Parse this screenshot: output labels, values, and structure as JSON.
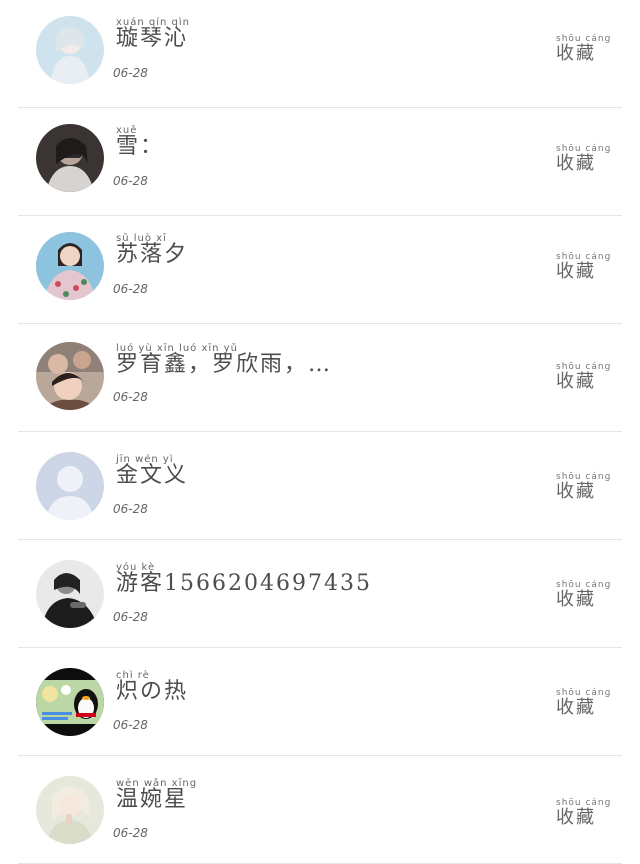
{
  "rows": [
    {
      "pinyin": "xuán  qín  qìn",
      "name": "璇琴沁",
      "date": "06-28",
      "avatar": "avatar-photo-light",
      "fav_pinyin": "shōu cáng",
      "fav_label": "收藏"
    },
    {
      "pinyin": "xuě",
      "name": "雪：",
      "date": "06-28",
      "avatar": "avatar-photo-dark",
      "fav_pinyin": "shōu cáng",
      "fav_label": "收藏"
    },
    {
      "pinyin": "sū   luò   xī",
      "name": "苏落夕",
      "date": "06-28",
      "avatar": "avatar-photo-girl",
      "fav_pinyin": "shōu cáng",
      "fav_label": "收藏"
    },
    {
      "pinyin": "luó  yù   xīn      luó  xīn  yǔ",
      "name": "罗育鑫，罗欣雨，…",
      "date": "06-28",
      "avatar": "avatar-photo-group",
      "fav_pinyin": "shōu cáng",
      "fav_label": "收藏"
    },
    {
      "pinyin": "jīn   wén   yì",
      "name": "金文义",
      "date": "06-28",
      "avatar": "avatar-default-silhouette",
      "fav_pinyin": "shōu cáng",
      "fav_label": "收藏"
    },
    {
      "pinyin": "yóu  kè",
      "name": "游客1566204697435",
      "date": "06-28",
      "avatar": "avatar-photo-grayscale",
      "fav_pinyin": "shōu cáng",
      "fav_label": "收藏"
    },
    {
      "pinyin": "chì         rè",
      "name": "炽の热",
      "date": "06-28",
      "avatar": "avatar-penguin-qq",
      "fav_pinyin": "shōu cáng",
      "fav_label": "收藏"
    },
    {
      "pinyin": "wēn  wǎn  xīng",
      "name": "温婉星",
      "date": "06-28",
      "avatar": "avatar-photo-pale",
      "fav_pinyin": "shōu cáng",
      "fav_label": "收藏"
    }
  ]
}
